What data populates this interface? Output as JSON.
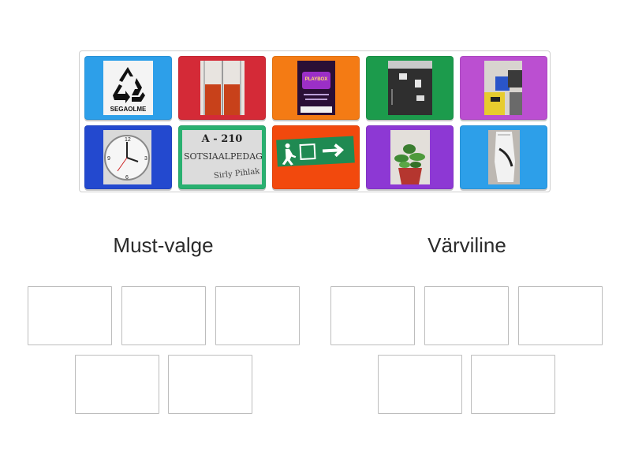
{
  "tray": {
    "cards": [
      {
        "id": "card-1",
        "color": "#2d9fe9",
        "image": "recycling-sign",
        "text": "SEGAOLME"
      },
      {
        "id": "card-2",
        "color": "#d42a37",
        "image": "red-doors"
      },
      {
        "id": "card-3",
        "color": "#f47b14",
        "image": "playbox-poster",
        "text": "PLAYBOX"
      },
      {
        "id": "card-4",
        "color": "#1c9b4c",
        "image": "black-door-stickers"
      },
      {
        "id": "card-5",
        "color": "#bb4fd1",
        "image": "colored-bins"
      },
      {
        "id": "card-6",
        "color": "#2349cf",
        "image": "wall-clock"
      },
      {
        "id": "card-7",
        "color": "#29b070",
        "image": "door-nameplate",
        "line1": "A - 210",
        "line2": "SOTSIAALPEDAGOOG",
        "line3": "Sirly Pihlak"
      },
      {
        "id": "card-8",
        "color": "#f2490d",
        "image": "exit-sign"
      },
      {
        "id": "card-9",
        "color": "#8d38d4",
        "image": "potted-plant"
      },
      {
        "id": "card-10",
        "color": "#2d9fe9",
        "image": "white-sneaker"
      }
    ]
  },
  "groups": [
    {
      "title": "Must-valge"
    },
    {
      "title": "Värviline"
    }
  ]
}
